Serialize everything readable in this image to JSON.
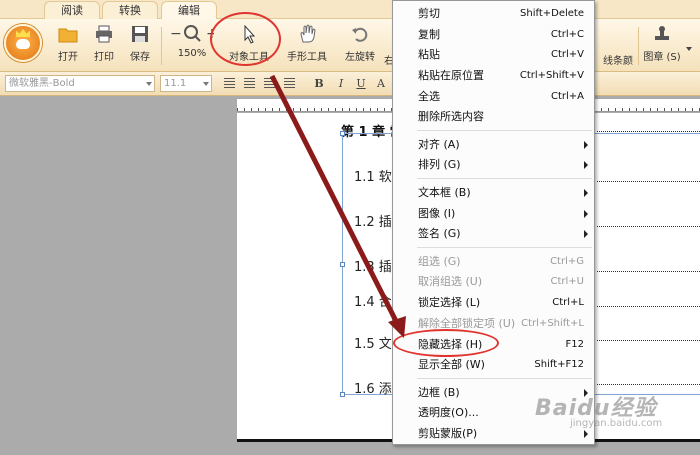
{
  "tabs": [
    {
      "label": "阅读"
    },
    {
      "label": "转换"
    },
    {
      "label": "编辑"
    }
  ],
  "ribbon": {
    "buttons": [
      {
        "label": "打开",
        "icon": "folder-icon"
      },
      {
        "label": "打印",
        "icon": "printer-icon"
      },
      {
        "label": "保存",
        "icon": "save-icon"
      },
      {
        "label": "150%",
        "icon": "zoom-icon"
      },
      {
        "label": "对象工具",
        "icon": "cursor-icon"
      },
      {
        "label": "手形工具",
        "icon": "hand-icon"
      },
      {
        "label": "左旋转",
        "icon": "rotate-left-icon"
      }
    ],
    "right_buttons": [
      {
        "label": "线条颜"
      },
      {
        "label": "图章 (S)",
        "icon": "stamp-icon"
      }
    ]
  },
  "format_bar": {
    "font_name": "微软雅黑-Bold",
    "font_size": "11.1",
    "bold": "B",
    "italic": "I",
    "underline": "U"
  },
  "document": {
    "chapter_title": "第 1 章  常",
    "sections": [
      "1.1 软件",
      "1.2 插入",
      "1.3 插入",
      "1.4 合",
      "1.5 文档",
      "1.6 添加"
    ]
  },
  "context_menu": {
    "items": [
      {
        "label": "剪切",
        "shortcut": "Shift+Delete"
      },
      {
        "label": "复制",
        "shortcut": "Ctrl+C"
      },
      {
        "label": "粘贴",
        "shortcut": "Ctrl+V"
      },
      {
        "label": "粘贴在原位置",
        "shortcut": "Ctrl+Shift+V"
      },
      {
        "label": "全选",
        "shortcut": "Ctrl+A"
      },
      {
        "label": "删除所选内容",
        "shortcut": ""
      },
      {
        "label": "对齐 (A)",
        "shortcut": "",
        "submenu": true
      },
      {
        "label": "排列 (G)",
        "shortcut": "",
        "submenu": true
      },
      {
        "label": "文本框 (B)",
        "shortcut": "",
        "submenu": true
      },
      {
        "label": "图像 (I)",
        "shortcut": "",
        "submenu": true
      },
      {
        "label": "签名 (G)",
        "shortcut": "",
        "submenu": true
      },
      {
        "label": "组选 (G)",
        "shortcut": "Ctrl+G",
        "disabled": true
      },
      {
        "label": "取消组选 (U)",
        "shortcut": "Ctrl+U",
        "disabled": true
      },
      {
        "label": "锁定选择 (L)",
        "shortcut": "Ctrl+L"
      },
      {
        "label": "解除全部锁定项 (U)",
        "shortcut": "Ctrl+Shift+L",
        "disabled": true
      },
      {
        "label": "隐藏选择 (H)",
        "shortcut": "F12"
      },
      {
        "label": "显示全部 (W)",
        "shortcut": "Shift+F12"
      },
      {
        "label": "边框 (B)",
        "shortcut": "",
        "submenu": true
      },
      {
        "label": "透明度(O)...",
        "shortcut": ""
      },
      {
        "label": "剪贴蒙版(P)",
        "shortcut": "",
        "submenu": true
      }
    ]
  },
  "annotation": {
    "arrow_color": "#8b1a1a",
    "circle_color": "#e0352f"
  },
  "watermark": {
    "main": "Baidu经验",
    "sub": "jingyan.baidu.com"
  }
}
